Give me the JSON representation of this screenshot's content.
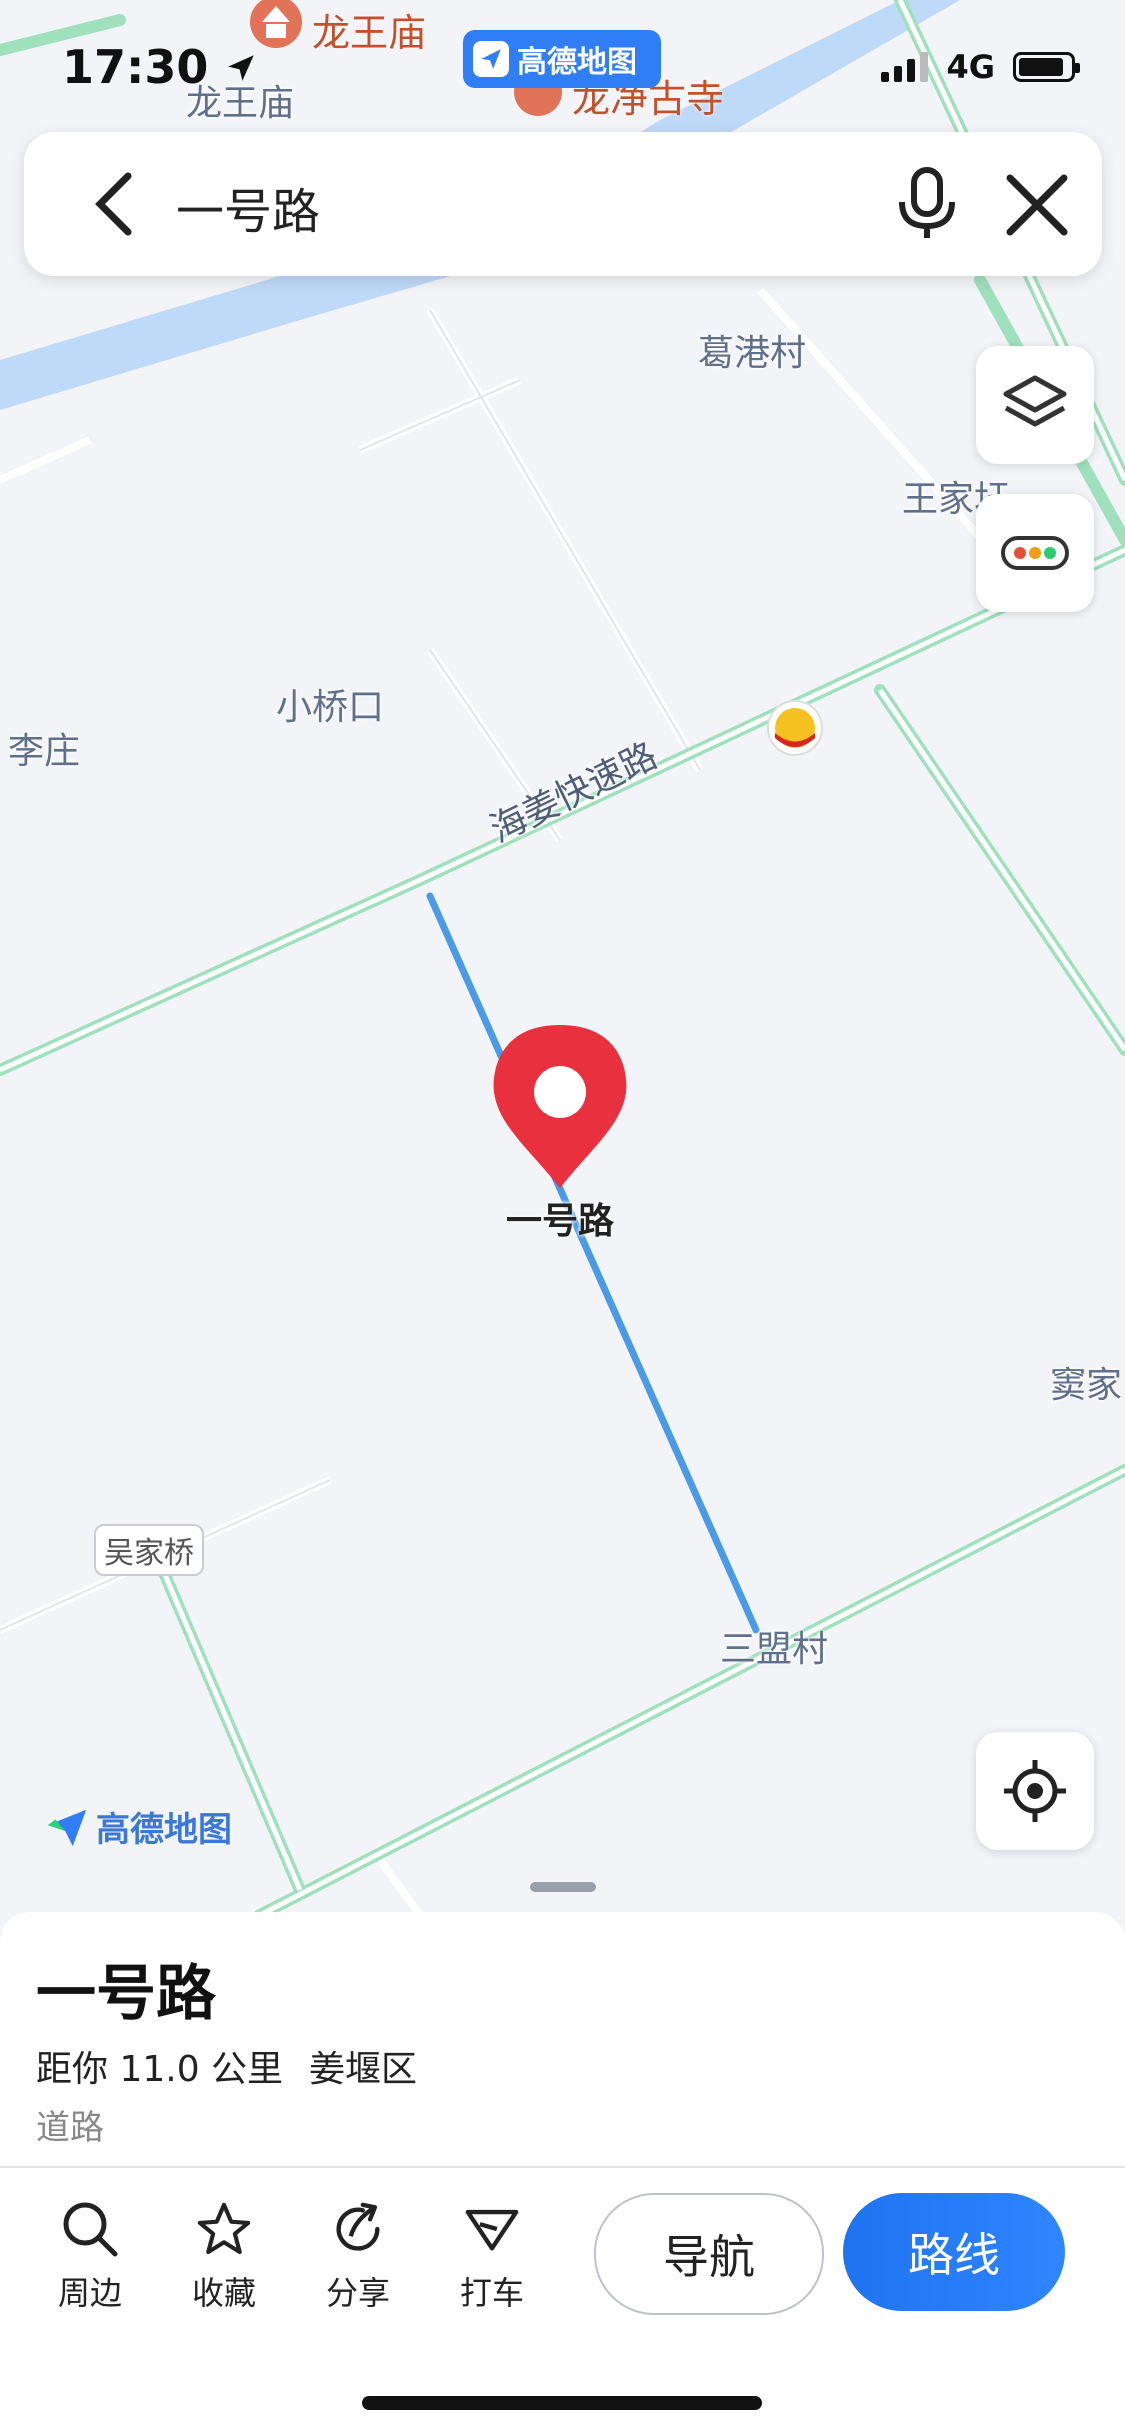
{
  "status": {
    "time": "17:30",
    "network": "4G"
  },
  "app_badge": {
    "label": "高德地图"
  },
  "search": {
    "query": "一号路"
  },
  "map": {
    "labels": {
      "longwangmiao_top": "龙王庙",
      "longwangmiao": "龙王庙",
      "longjing_temple": "龙净古寺",
      "gegang": "葛港村",
      "wangjiadu": "王家圩",
      "xiaoqiaokou": "小桥口",
      "lizhuang": "李庄",
      "expressway": "海姜快速路",
      "selected_road": "一号路",
      "doujia": "窦家",
      "wujiaqiao": "吴家桥",
      "sanmeng": "三盟村"
    },
    "watermark": "高德地图",
    "colors": {
      "water": "#b9d6f7",
      "road_green": "#9fe0bd",
      "selected_road": "#4a9ae6",
      "pin": "#e8303f"
    }
  },
  "place": {
    "name": "一号路",
    "distance": "距你 11.0 公里",
    "district": "姜堰区",
    "type": "道路"
  },
  "actions": {
    "nearby": "周边",
    "favorite": "收藏",
    "share": "分享",
    "taxi": "打车",
    "navigate": "导航",
    "route": "路线"
  }
}
